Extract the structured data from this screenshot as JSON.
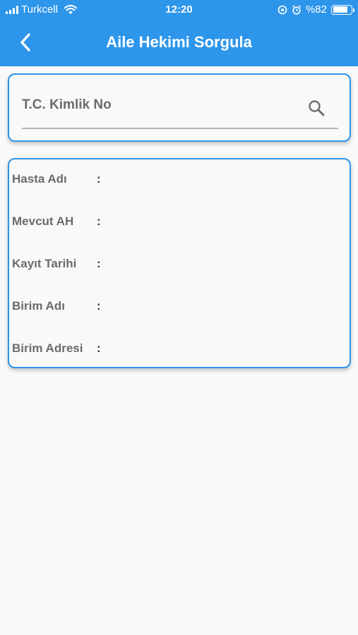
{
  "status_bar": {
    "carrier": "Turkcell",
    "time": "12:20",
    "battery": "%82",
    "battery_level": 0.82
  },
  "nav": {
    "title": "Aile Hekimi Sorgula",
    "back_icon": "chevron-left-icon"
  },
  "search": {
    "placeholder": "T.C. Kimlik No",
    "value": "",
    "icon": "search-icon"
  },
  "patient_info": {
    "colon": ":",
    "rows": [
      {
        "label": "Hasta Adı",
        "value": ""
      },
      {
        "label": "Mevcut AH",
        "value": ""
      },
      {
        "label": "Kayıt Tarihi",
        "value": ""
      },
      {
        "label": "Birim Adı",
        "value": ""
      },
      {
        "label": "Birim Adresi",
        "value": ""
      }
    ]
  },
  "colors": {
    "accent": "#2d95ea",
    "background": "#f9f9f9",
    "label_text": "#6b6b6b"
  }
}
